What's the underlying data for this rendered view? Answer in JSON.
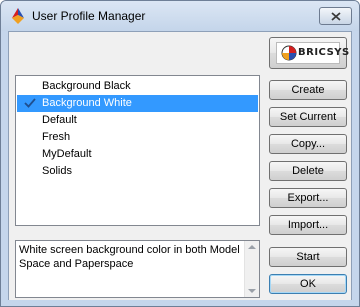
{
  "window": {
    "title": "User Profile Manager",
    "close_icon": "close-icon"
  },
  "logo": {
    "text": "BRICSYS"
  },
  "profiles": {
    "items": [
      {
        "label": "Background Black",
        "selected": false,
        "current": false
      },
      {
        "label": "Background White",
        "selected": true,
        "current": true
      },
      {
        "label": "Default",
        "selected": false,
        "current": false
      },
      {
        "label": "Fresh",
        "selected": false,
        "current": false
      },
      {
        "label": "MyDefault",
        "selected": false,
        "current": false
      },
      {
        "label": "Solids",
        "selected": false,
        "current": false
      }
    ]
  },
  "description": {
    "text": "White screen background color in both Model Space and Paperspace"
  },
  "buttons": {
    "create": "Create",
    "set_current": "Set Current",
    "copy": "Copy...",
    "delete": "Delete",
    "export": "Export...",
    "import": "Import...",
    "start": "Start",
    "ok": "OK"
  },
  "colors": {
    "selection": "#3399ff",
    "frame": "#c5d6ec"
  }
}
